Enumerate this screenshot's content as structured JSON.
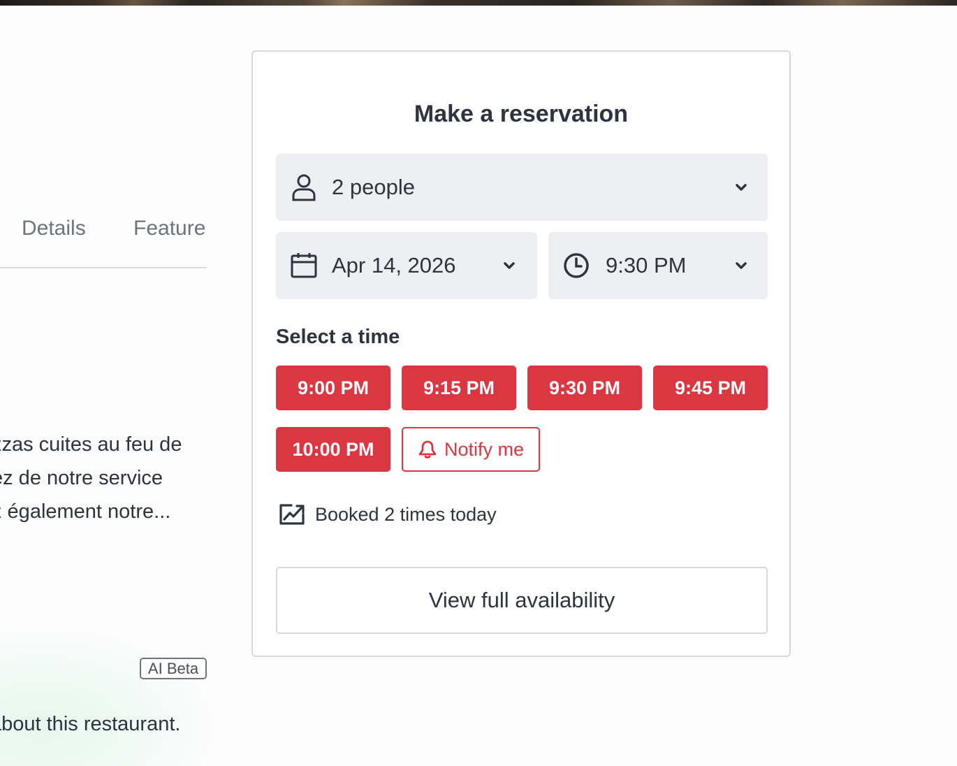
{
  "left_panel": {
    "tabs": [
      "Details",
      "Feature"
    ],
    "about_lines": [
      "zzas cuites au feu de",
      "ez de notre service",
      "z également notre..."
    ],
    "ai_badge": "AI Beta",
    "ai_summary_fragment": "about this restaurant."
  },
  "reservation": {
    "title": "Make a reservation",
    "party": {
      "value": "2 people",
      "icon": "person-icon"
    },
    "date": {
      "value": "Apr 14, 2026",
      "icon": "calendar-icon"
    },
    "time": {
      "value": "9:30 PM",
      "icon": "clock-icon"
    },
    "select_time_heading": "Select a time",
    "slots": [
      "9:00 PM",
      "9:15 PM",
      "9:30 PM",
      "9:45 PM",
      "10:00 PM"
    ],
    "notify_label": "Notify me",
    "booked_text": "Booked 2 times today",
    "view_full_label": "View full availability"
  },
  "colors": {
    "accent": "#da3743",
    "field_bg": "#eeeff2",
    "text": "#2d333f",
    "border": "#d8d9db"
  }
}
